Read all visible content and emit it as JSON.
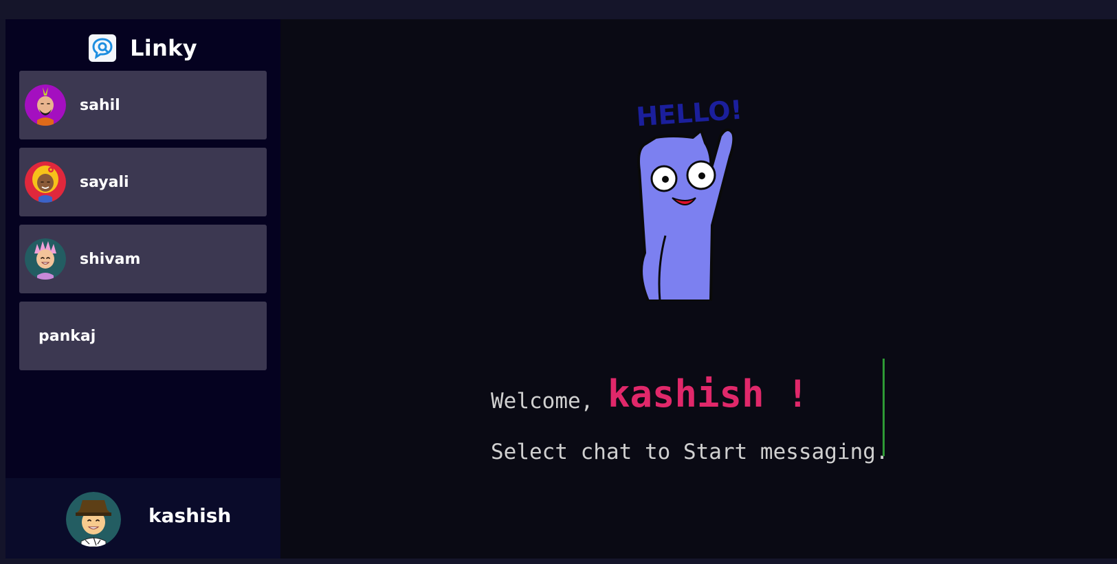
{
  "app": {
    "title": "Linky"
  },
  "sidebar": {
    "chats": [
      {
        "name": "sahil",
        "avatar": "avatar-sahil"
      },
      {
        "name": "sayali",
        "avatar": "avatar-sayali"
      },
      {
        "name": "shivam",
        "avatar": "avatar-shivam"
      },
      {
        "name": "pankaj",
        "avatar": ""
      }
    ]
  },
  "current_user": {
    "name": "kashish"
  },
  "main": {
    "sticker_text": "HELLO!",
    "welcome_word": "Welcome,",
    "welcome_name": "kashish !",
    "select_prompt": "Select chat to Start messaging."
  },
  "colors": {
    "accent_pink": "#e0286a",
    "cursor_green": "#2e9a35",
    "sidebar_bg": "#050220",
    "chat_item_bg": "#3c3851",
    "main_bg": "#0a0a14"
  }
}
